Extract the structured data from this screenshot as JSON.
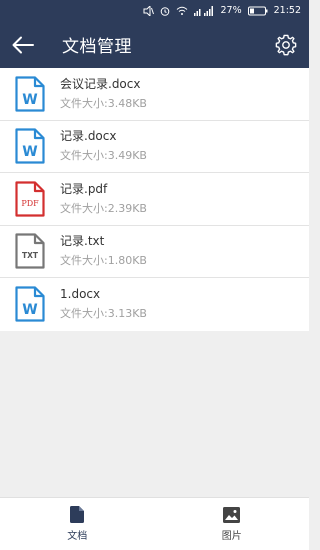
{
  "status_bar": {
    "battery": "27%",
    "time": "21:52"
  },
  "app_bar": {
    "title": "文档管理"
  },
  "files": [
    {
      "name": "会议记录.docx",
      "size": "文件大小:3.48KB",
      "type": "word",
      "icon_label": "W"
    },
    {
      "name": "记录.docx",
      "size": "文件大小:3.49KB",
      "type": "word",
      "icon_label": "W"
    },
    {
      "name": "记录.pdf",
      "size": "文件大小:2.39KB",
      "type": "pdf",
      "icon_label": "PDF"
    },
    {
      "name": "记录.txt",
      "size": "文件大小:1.80KB",
      "type": "txt",
      "icon_label": "TXT"
    },
    {
      "name": "1.docx",
      "size": "文件大小:3.13KB",
      "type": "word",
      "icon_label": "W"
    }
  ],
  "bottom_nav": [
    {
      "label": "文档",
      "icon": "document-icon",
      "active": true
    },
    {
      "label": "图片",
      "icon": "image-icon",
      "active": false
    }
  ],
  "colors": {
    "primary": "#2d3c5a",
    "word": "#2a8ad4",
    "pdf": "#d32f2f",
    "txt": "#777777"
  }
}
